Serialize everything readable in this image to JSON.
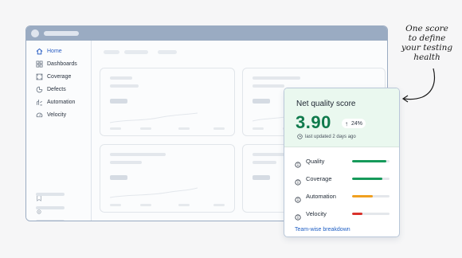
{
  "sidebar": {
    "items": [
      {
        "label": "Home",
        "icon": "home-icon",
        "active": true
      },
      {
        "label": "Dashboards",
        "icon": "dashboard-icon",
        "active": false
      },
      {
        "label": "Coverage",
        "icon": "coverage-icon",
        "active": false
      },
      {
        "label": "Defects",
        "icon": "defects-icon",
        "active": false
      },
      {
        "label": "Automation",
        "icon": "automation-icon",
        "active": false
      },
      {
        "label": "Velocity",
        "icon": "velocity-icon",
        "active": false
      }
    ]
  },
  "score_card": {
    "title": "Net quality score",
    "value": "3.90",
    "delta": "24%",
    "updated": "last updated 2 days ago",
    "metrics": [
      {
        "label": "Quality",
        "level": 0.92,
        "color": "#169a5a"
      },
      {
        "label": "Coverage",
        "level": 0.8,
        "color": "#169a5a"
      },
      {
        "label": "Automation",
        "level": 0.56,
        "color": "#f0a020"
      },
      {
        "label": "Velocity",
        "level": 0.27,
        "color": "#d9322b"
      }
    ],
    "link": "Team-wise breakdown"
  },
  "annotation": {
    "lines": [
      "One score",
      "to define",
      "your testing",
      "health"
    ]
  },
  "colors": {
    "active_nav": "#2b5fc4",
    "score_green": "#0f7a4c",
    "header_bg": "#eaf8ef"
  }
}
